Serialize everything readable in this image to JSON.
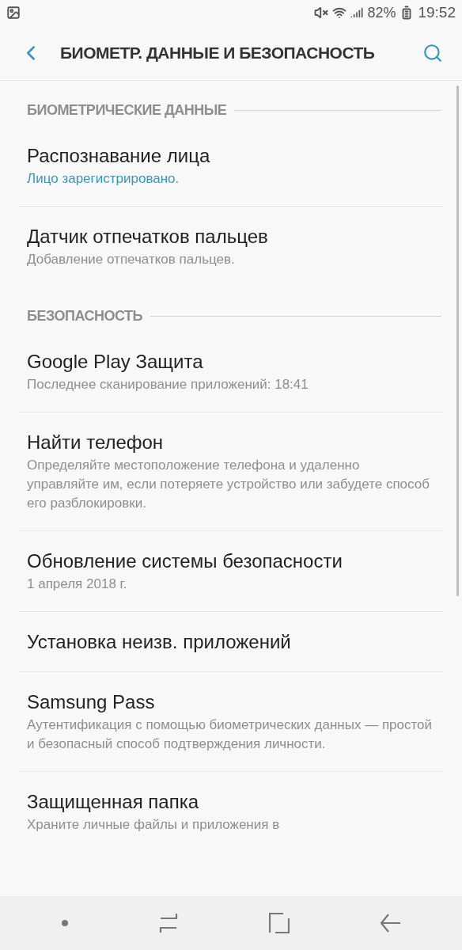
{
  "status_bar": {
    "battery": "82%",
    "time": "19:52"
  },
  "header": {
    "title": "БИОМЕТР. ДАННЫЕ И БЕЗОПАСНОСТЬ"
  },
  "sections": [
    {
      "title": "БИОМЕТРИЧЕСКИЕ ДАННЫЕ",
      "items": [
        {
          "title": "Распознавание лица",
          "subtitle": "Лицо зарегистрировано.",
          "accent": true
        },
        {
          "title": "Датчик отпечатков пальцев",
          "subtitle": "Добавление отпечатков пальцев."
        }
      ]
    },
    {
      "title": "БЕЗОПАСНОСТЬ",
      "items": [
        {
          "title": "Google Play Защита",
          "subtitle": "Последнее сканирование приложений: 18:41"
        },
        {
          "title": "Найти телефон",
          "subtitle": "Определяйте местоположение телефона и удаленно управляйте им, если потеряете устройство или забудете способ его разблокировки."
        },
        {
          "title": "Обновление системы безопасности",
          "subtitle": "1 апреля 2018 г."
        },
        {
          "title": "Установка неизв. приложений"
        },
        {
          "title": "Samsung Pass",
          "subtitle": "Аутентификация с помощью биометрических данных — простой и безопасный способ подтверждения личности."
        },
        {
          "title": "Защищенная папка",
          "subtitle": "Храните личные файлы и приложения в"
        }
      ]
    }
  ]
}
